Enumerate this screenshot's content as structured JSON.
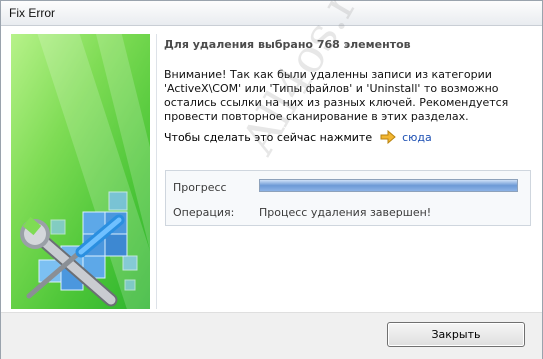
{
  "window": {
    "title": "Fix Error"
  },
  "main": {
    "heading": "Для удаления выбрано 768 элементов",
    "warning": "Внимание! Так как были удаленны записи из категории 'ActiveX\\COM' или 'Типы файлов' и 'Uninstall' то возможно остались ссылки на них из разных ключей. Рекомендуется провести повторное сканирование в этих разделах.",
    "action_text": "Чтобы сделать это сейчас нажмите",
    "action_link": "сюда",
    "arrow_icon": "arrow-right-icon"
  },
  "progress": {
    "label": "Прогресс",
    "value": 1.0,
    "operation_label": "Операция:",
    "operation_value": "Процесс удаления завершен!"
  },
  "footer": {
    "close_label": "Закрыть"
  },
  "watermark": "All4os.ru",
  "colors": {
    "link": "#1c4fb3",
    "panel_green": "#4dc638",
    "progress_blue": "#6d9ad6"
  }
}
